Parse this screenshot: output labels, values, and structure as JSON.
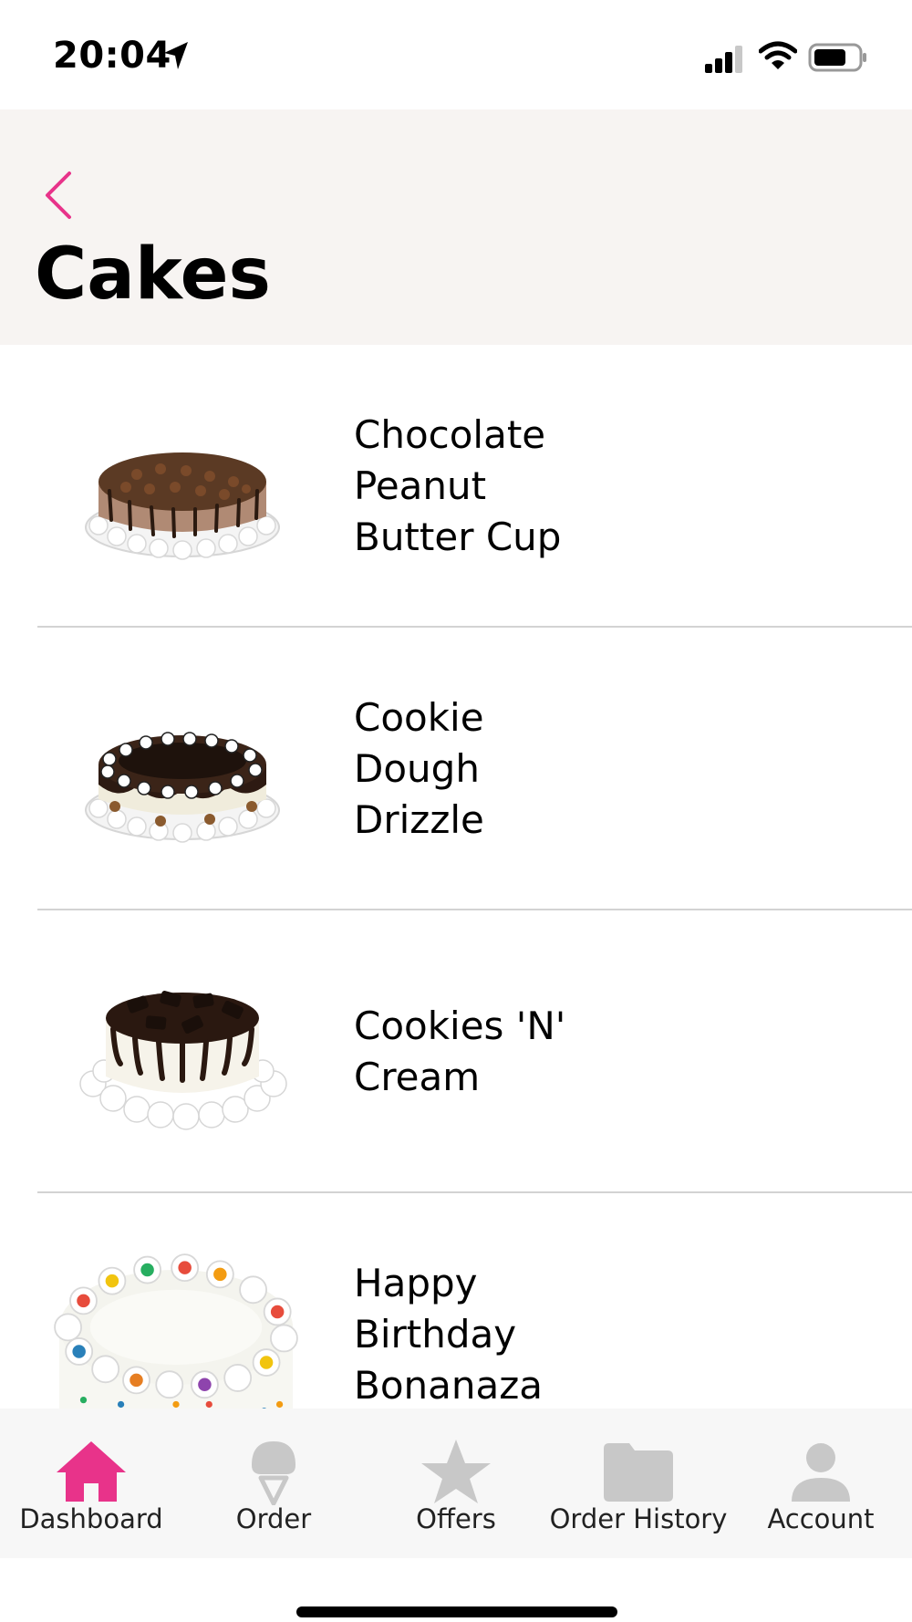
{
  "status_bar": {
    "time": "20:04"
  },
  "header": {
    "title": "Cakes"
  },
  "cakes": [
    {
      "name": "Chocolate\nPeanut\nButter Cup"
    },
    {
      "name": "Cookie\nDough\nDrizzle"
    },
    {
      "name": "Cookies 'N'\nCream"
    },
    {
      "name": "Happy\nBirthday\nBonanaza"
    }
  ],
  "tabs": [
    {
      "label": "Dashboard",
      "icon": "home-icon",
      "active": true
    },
    {
      "label": "Order",
      "icon": "ice-cream-icon",
      "active": false
    },
    {
      "label": "Offers",
      "icon": "star-icon",
      "active": false
    },
    {
      "label": "Order History",
      "icon": "folder-icon",
      "active": false
    },
    {
      "label": "Account",
      "icon": "person-icon",
      "active": false
    }
  ],
  "colors": {
    "accent": "#e8338a",
    "inactive_icon": "#c8c8c8",
    "header_bg": "#f7f4f2"
  }
}
